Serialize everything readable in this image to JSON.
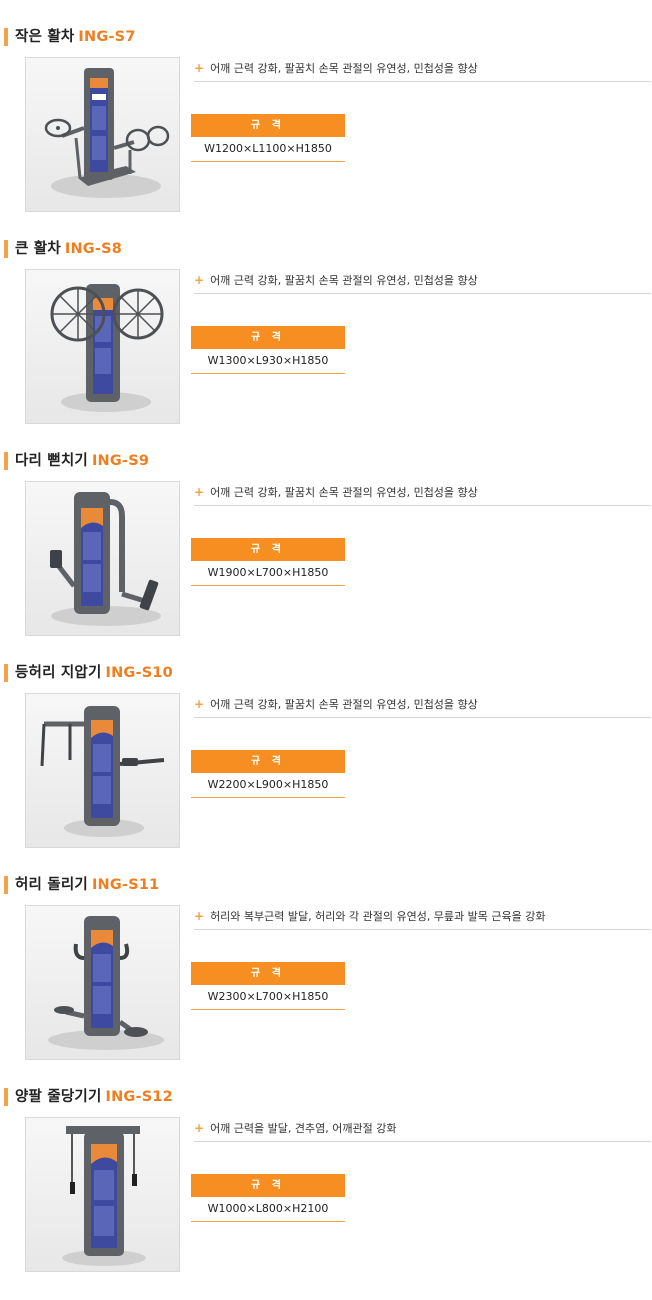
{
  "sections": [
    {
      "name": "작은 활차",
      "code": "ING-S7",
      "photo_icon": "small-pulley-equipment-photo",
      "description": "어깨 근력 강화, 팔꿈치 손목 관절의 유연성, 민첩성을 향상",
      "spec_label": "규 격",
      "spec_value": "W1200×L1100×H1850"
    },
    {
      "name": "큰 활차",
      "code": "ING-S8",
      "photo_icon": "large-pulley-equipment-photo",
      "description": "어깨 근력 강화, 팔꿈치 손목 관절의 유연성, 민첩성을 향상",
      "spec_label": "규 격",
      "spec_value": "W1300×L930×H1850"
    },
    {
      "name": "다리 뻗치기",
      "code": "ING-S9",
      "photo_icon": "leg-stretch-equipment-photo",
      "description": "어깨 근력 강화, 팔꿈치 손목 관절의 유연성, 민첩성을 향상",
      "spec_label": "규 격",
      "spec_value": "W1900×L700×H1850"
    },
    {
      "name": "등허리 지압기",
      "code": "ING-S10",
      "photo_icon": "back-massager-equipment-photo",
      "description": "어깨 근력 강화, 팔꿈치 손목 관절의 유연성, 민첩성을 향상",
      "spec_label": "규 격",
      "spec_value": "W2200×L900×H1850"
    },
    {
      "name": "허리 돌리기",
      "code": "ING-S11",
      "photo_icon": "waist-twister-equipment-photo",
      "description": "허리와 복부근력 발달, 허리와 각 관절의 유연성, 무릎과 발목 근육을 강화",
      "spec_label": "규 격",
      "spec_value": "W2300×L700×H1850"
    },
    {
      "name": "양팔 줄당기기",
      "code": "ING-S12",
      "photo_icon": "arm-rope-pull-equipment-photo",
      "description": "어깨 근력을 발달, 견추염, 어깨관절 강화",
      "spec_label": "규 격",
      "spec_value": "W1000×L800×H2100"
    }
  ],
  "colors": {
    "accent": "#f68e21",
    "code_text": "#f07e1e",
    "title_bar": "#f3a24a",
    "panel_blue": "#3d4aa0",
    "frame_gray": "#5e6266"
  }
}
